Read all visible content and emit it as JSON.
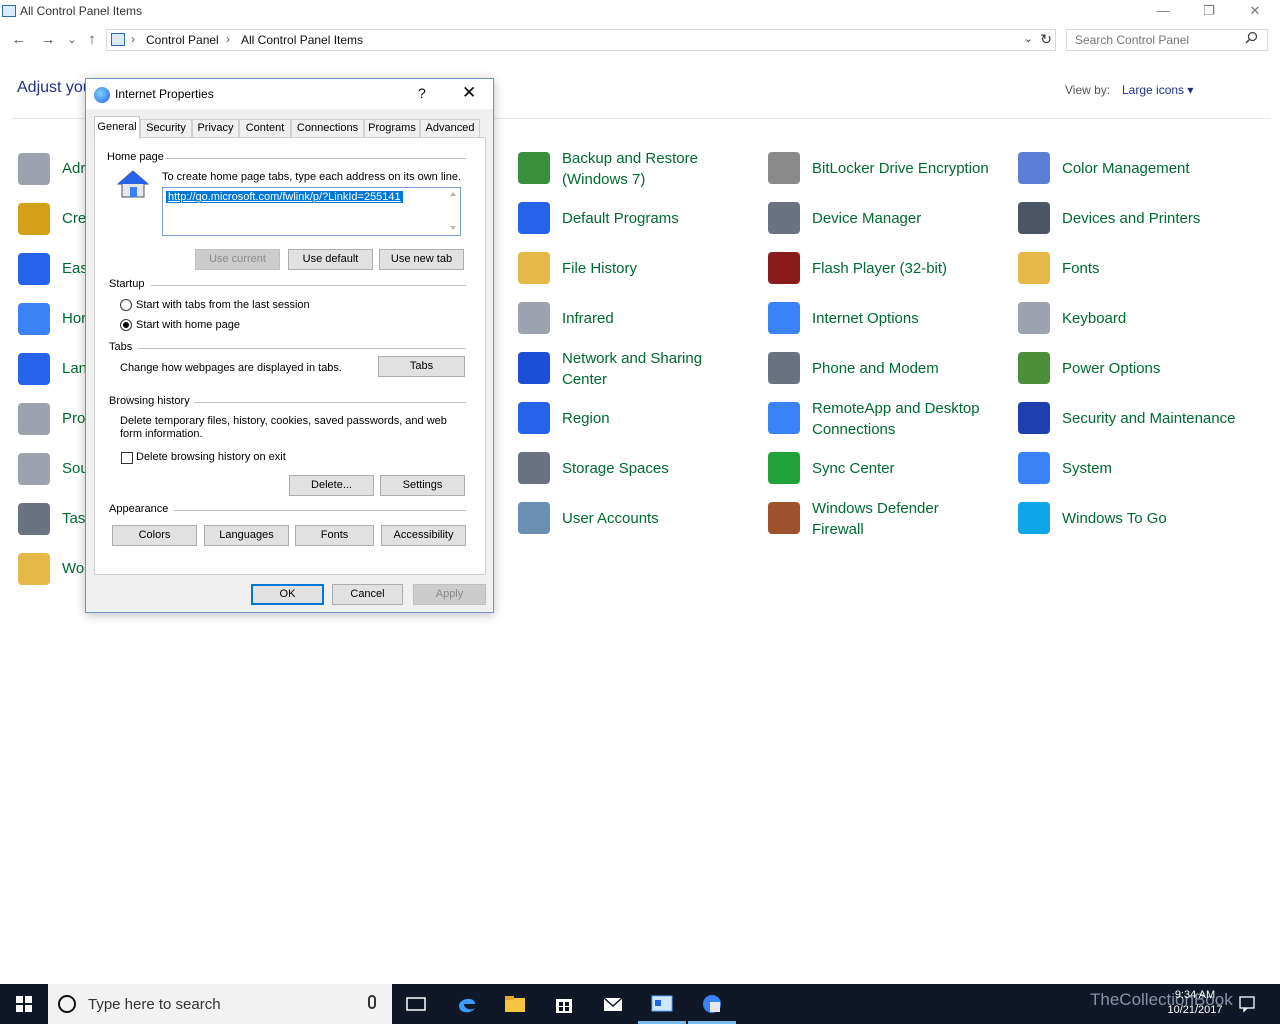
{
  "window": {
    "title": "All Control Panel Items",
    "min_glyph": "—",
    "max_glyph": "❐",
    "close_glyph": "✕"
  },
  "nav": {
    "back_glyph": "←",
    "forward_glyph": "→",
    "recent_glyph": "⌄",
    "up_glyph": "↑",
    "breadcrumb": [
      "Control Panel",
      "All Control Panel Items"
    ],
    "sep_glyph": "›",
    "dropdown_glyph": "⌄",
    "refresh_glyph": "↻",
    "search_placeholder": "Search Control Panel"
  },
  "content": {
    "heading": "Adjust you",
    "view_by_label": "View by:",
    "view_by_value": "Large icons ▾",
    "left_partial_items": [
      "Adr",
      "Cre",
      "Eas",
      "Hor",
      "Lan",
      "Pro",
      "Sou",
      "Tasl",
      "Wo"
    ],
    "items": [
      {
        "label_lines": [
          "Backup and Restore",
          "(Windows 7)"
        ],
        "color": "#3b8f3b"
      },
      {
        "label_lines": [
          "BitLocker Drive Encryption"
        ],
        "color": "#8a8a8a"
      },
      {
        "label_lines": [
          "Color Management"
        ],
        "color": "#5b7fd6"
      },
      {
        "label_lines": [
          "Default Programs"
        ],
        "color": "#2563eb"
      },
      {
        "label_lines": [
          "Device Manager"
        ],
        "color": "#6b7280"
      },
      {
        "label_lines": [
          "Devices and Printers"
        ],
        "color": "#4b5563"
      },
      {
        "label_lines": [
          "File History"
        ],
        "color": "#e6b84a"
      },
      {
        "label_lines": [
          "Flash Player (32-bit)"
        ],
        "color": "#8b1a1a"
      },
      {
        "label_lines": [
          "Fonts"
        ],
        "color": "#e6b84a"
      },
      {
        "label_lines": [
          "Infrared"
        ],
        "color": "#9ca3af"
      },
      {
        "label_lines": [
          "Internet Options"
        ],
        "color": "#3b82f6"
      },
      {
        "label_lines": [
          "Keyboard"
        ],
        "color": "#9ca3af"
      },
      {
        "label_lines": [
          "Network and Sharing",
          "Center"
        ],
        "color": "#1d4ed8"
      },
      {
        "label_lines": [
          "Phone and Modem"
        ],
        "color": "#6b7280"
      },
      {
        "label_lines": [
          "Power Options"
        ],
        "color": "#4b8f3b"
      },
      {
        "label_lines": [
          "Region"
        ],
        "color": "#2563eb"
      },
      {
        "label_lines": [
          "RemoteApp and Desktop",
          "Connections"
        ],
        "color": "#3b82f6"
      },
      {
        "label_lines": [
          "Security and Maintenance"
        ],
        "color": "#1e40af"
      },
      {
        "label_lines": [
          "Storage Spaces"
        ],
        "color": "#6b7280"
      },
      {
        "label_lines": [
          "Sync Center"
        ],
        "color": "#22a33a"
      },
      {
        "label_lines": [
          "System"
        ],
        "color": "#3b82f6"
      },
      {
        "label_lines": [
          "User Accounts"
        ],
        "color": "#6b8fb3"
      },
      {
        "label_lines": [
          "Windows Defender",
          "Firewall"
        ],
        "color": "#a0522d"
      },
      {
        "label_lines": [
          "Windows To Go"
        ],
        "color": "#0ea5e9"
      }
    ]
  },
  "dialog": {
    "title": "Internet Properties",
    "help_glyph": "?",
    "close_glyph": "✕",
    "tabs": [
      "General",
      "Security",
      "Privacy",
      "Content",
      "Connections",
      "Programs",
      "Advanced"
    ],
    "active_tab": "General",
    "home_page": {
      "section": "Home page",
      "instruction": "To create home page tabs, type each address on its own line.",
      "url": "http://go.microsoft.com/fwlink/p/?LinkId=255141",
      "use_current": "Use current",
      "use_default": "Use default",
      "use_new_tab": "Use new tab"
    },
    "startup": {
      "section": "Startup",
      "opt_last_session": "Start with tabs from the last session",
      "opt_home_page": "Start with home page",
      "selected": "home_page"
    },
    "tabs_section": {
      "section": "Tabs",
      "desc": "Change how webpages are displayed in tabs.",
      "button": "Tabs"
    },
    "browsing_history": {
      "section": "Browsing history",
      "desc_line1": "Delete temporary files, history, cookies, saved passwords, and web",
      "desc_line2": "form information.",
      "delete_on_exit": "Delete browsing history on exit",
      "delete_on_exit_checked": false,
      "delete_button": "Delete...",
      "settings_button": "Settings"
    },
    "appearance": {
      "section": "Appearance",
      "colors": "Colors",
      "languages": "Languages",
      "fonts": "Fonts",
      "accessibility": "Accessibility"
    },
    "footer": {
      "ok": "OK",
      "cancel": "Cancel",
      "apply": "Apply"
    }
  },
  "taskbar": {
    "search_placeholder": "Type here to search",
    "watermark": "TheCollectionBook",
    "time": "9:34 AM",
    "date": "10/21/2017"
  }
}
